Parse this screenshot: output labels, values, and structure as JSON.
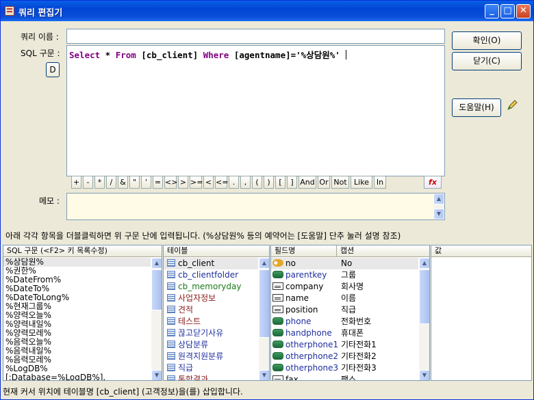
{
  "window": {
    "title": "쿼리 편집기",
    "minimize": "_",
    "maximize": "□",
    "close": "✕"
  },
  "form": {
    "query_name_label": "쿼리 이름 :",
    "query_name_value": "",
    "sql_label": "SQL 구문 :",
    "d_button": "D",
    "sql_tokens": [
      {
        "t": "Select",
        "kw": true
      },
      {
        "t": " * ",
        "kw": false
      },
      {
        "t": "From",
        "kw": true
      },
      {
        "t": " [cb_client] ",
        "kw": false
      },
      {
        "t": "Where",
        "kw": true
      },
      {
        "t": " [agentname]='%상담원%'",
        "kw": false
      }
    ],
    "memo_label": "메모 :",
    "memo_value": ""
  },
  "buttons": {
    "ok": "확인(O)",
    "close": "닫기(C)",
    "help": "도움말(H)"
  },
  "operators": [
    "+",
    "-",
    "*",
    "/",
    "&",
    "\"",
    "'",
    "=",
    "<>",
    ">",
    ">=",
    "<",
    "<=",
    ".",
    ",",
    "(",
    ")",
    "[",
    "]",
    "And",
    "Or",
    "Not",
    "Like",
    "In"
  ],
  "fx_label": "fx",
  "help_text": "아래 각각 항목을 더블클릭하면 위 구문 난에 입력됩니다. (%상담원% 등의 예약어는 [도움말] 단추 눌러 설명 참조)",
  "panels": {
    "sql": {
      "header": "SQL 구문 (<F2> 키 목록수정)",
      "items": [
        "%상담원%",
        "%권한%",
        "%DateFrom%",
        "%DateTo%",
        "%DateToLong%",
        "%현재그룹%",
        "%양력오늘%",
        "%양력내일%",
        "%양력모레%",
        "%음력오늘%",
        "%음력내일%",
        "%음력모레%",
        "%LogDB%",
        "[;Database=%LogDB%]."
      ]
    },
    "tables": {
      "header": "테이블",
      "items": [
        {
          "name": "cb_client",
          "color": "#000000"
        },
        {
          "name": "cb_clientfolder",
          "color": "#1f2f9f"
        },
        {
          "name": "cb_memoryday",
          "color": "#1a7a1a"
        },
        {
          "name": "사업자정보",
          "color": "#8a1a1a"
        },
        {
          "name": "견적",
          "color": "#8a1a1a"
        },
        {
          "name": "테스트",
          "color": "#8a1a1a"
        },
        {
          "name": "끊고닫기사유",
          "color": "#1f2f9f"
        },
        {
          "name": "상담분류",
          "color": "#1f2f9f"
        },
        {
          "name": "원격지원분류",
          "color": "#1f2f9f"
        },
        {
          "name": "직급",
          "color": "#1f2f9f"
        },
        {
          "name": "통합결과",
          "color": "#8a1a1a"
        }
      ]
    },
    "fields": {
      "header_name": "필드명",
      "header_caption": "캡션",
      "items": [
        {
          "name": "no",
          "caption": "No",
          "icon": "key-icon",
          "color": "#000000"
        },
        {
          "name": "parentkey",
          "caption": "그룹",
          "icon": "link-field-icon",
          "color": "#1f2f9f"
        },
        {
          "name": "company",
          "caption": "회사명",
          "icon": "text-field-icon",
          "color": "#000000"
        },
        {
          "name": "name",
          "caption": "이름",
          "icon": "text-field-icon",
          "color": "#000000"
        },
        {
          "name": "position",
          "caption": "직급",
          "icon": "text-field-icon",
          "color": "#000000"
        },
        {
          "name": "phone",
          "caption": "전화번호",
          "icon": "link-field-icon",
          "color": "#1f2f9f"
        },
        {
          "name": "handphone",
          "caption": "휴대폰",
          "icon": "link-field-icon",
          "color": "#1f2f9f"
        },
        {
          "name": "otherphone1",
          "caption": "기타전화1",
          "icon": "link-field-icon",
          "color": "#1f2f9f"
        },
        {
          "name": "otherphone2",
          "caption": "기타전화2",
          "icon": "link-field-icon",
          "color": "#1f2f9f"
        },
        {
          "name": "otherphone3",
          "caption": "기타전화3",
          "icon": "link-field-icon",
          "color": "#1f2f9f"
        },
        {
          "name": "fax",
          "caption": "팩스",
          "icon": "text-field-icon",
          "color": "#000000"
        }
      ]
    },
    "values": {
      "header": "값"
    }
  },
  "status": "현재 커서 위치에 테이블명 [cb_client] (고객정보)을(를) 삽입합니다."
}
